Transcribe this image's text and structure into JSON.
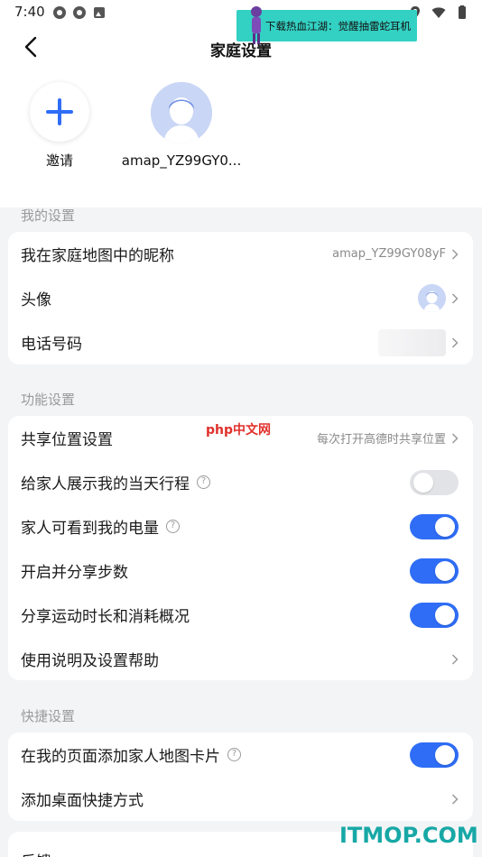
{
  "status_bar": {
    "time": "7:40"
  },
  "ad_banner": {
    "text": "下载热血江湖：觉醒抽雷蛇耳机"
  },
  "header": {
    "title": "家庭设置"
  },
  "members": [
    {
      "label": "邀请"
    },
    {
      "label": "amap_YZ99GY0..."
    }
  ],
  "sections": {
    "my_settings": {
      "title": "我的设置",
      "nickname_label": "我在家庭地图中的昵称",
      "nickname_value": "amap_YZ99GY08yF",
      "avatar_label": "头像",
      "phone_label": "电话号码"
    },
    "features": {
      "title": "功能设置",
      "share_location_label": "共享位置设置",
      "share_location_value": "每次打开高德时共享位置",
      "show_itinerary_label": "给家人展示我的当天行程",
      "battery_label": "家人可看到我的电量",
      "steps_label": "开启并分享步数",
      "exercise_label": "分享运动时长和消耗概况",
      "help_label": "使用说明及设置帮助"
    },
    "shortcuts": {
      "title": "快捷设置",
      "card_label": "在我的页面添加家人地图卡片",
      "desktop_label": "添加桌面快捷方式"
    },
    "feedback": {
      "label": "反馈"
    }
  },
  "toggles": {
    "show_itinerary": false,
    "battery": true,
    "steps": true,
    "exercise": true,
    "map_card": true
  },
  "watermarks": {
    "php": "php中文网",
    "itmop": "ITMOP.COM"
  },
  "colors": {
    "accent": "#2f6df6",
    "banner": "#33d1c3",
    "page_bg": "#f3f4f6"
  }
}
